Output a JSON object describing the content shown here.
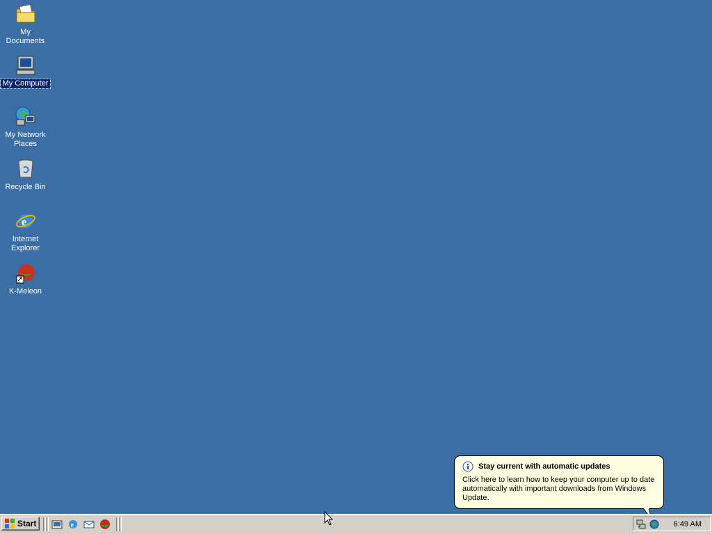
{
  "desktop": {
    "icons": [
      {
        "label": "My Documents",
        "icon": "my-documents-folder-icon"
      },
      {
        "label": "My Computer",
        "icon": "my-computer-icon",
        "selected": true
      },
      {
        "label": "My Network Places",
        "icon": "network-places-icon"
      },
      {
        "label": "Recycle Bin",
        "icon": "recycle-bin-icon"
      },
      {
        "label": "Internet Explorer",
        "icon": "internet-explorer-icon"
      },
      {
        "label": "K-Meleon",
        "icon": "k-meleon-icon"
      }
    ]
  },
  "taskbar": {
    "start_label": "Start",
    "quick_launch": [
      "show-desktop-icon",
      "internet-explorer-icon",
      "outlook-express-icon",
      "k-meleon-icon"
    ],
    "tray_icons": [
      "network-connection-icon",
      "windows-update-icon"
    ],
    "clock": "6:49 AM"
  },
  "balloon": {
    "title": "Stay current with automatic updates",
    "body": "Click here to learn how to keep your computer up to date automatically with important downloads from Windows Update."
  },
  "colors": {
    "desktop_background": "#3a6ea5",
    "taskbar": "#d4d0c8",
    "balloon_background": "#ffffe1",
    "selection": "#0a246a"
  }
}
